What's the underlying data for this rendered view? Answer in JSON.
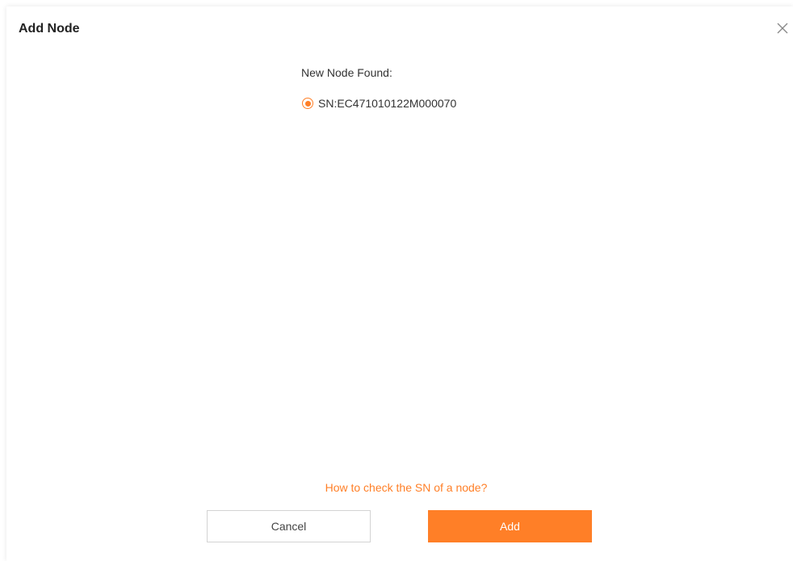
{
  "dialog": {
    "title": "Add Node",
    "close_icon": "close-icon"
  },
  "content": {
    "found_label": "New Node Found:",
    "nodes": [
      {
        "label": "SN:EC471010122M000070",
        "selected": true
      }
    ],
    "help_link": "How to check the SN of a node?"
  },
  "buttons": {
    "cancel": "Cancel",
    "add": "Add"
  },
  "colors": {
    "accent": "#FF7F27"
  }
}
